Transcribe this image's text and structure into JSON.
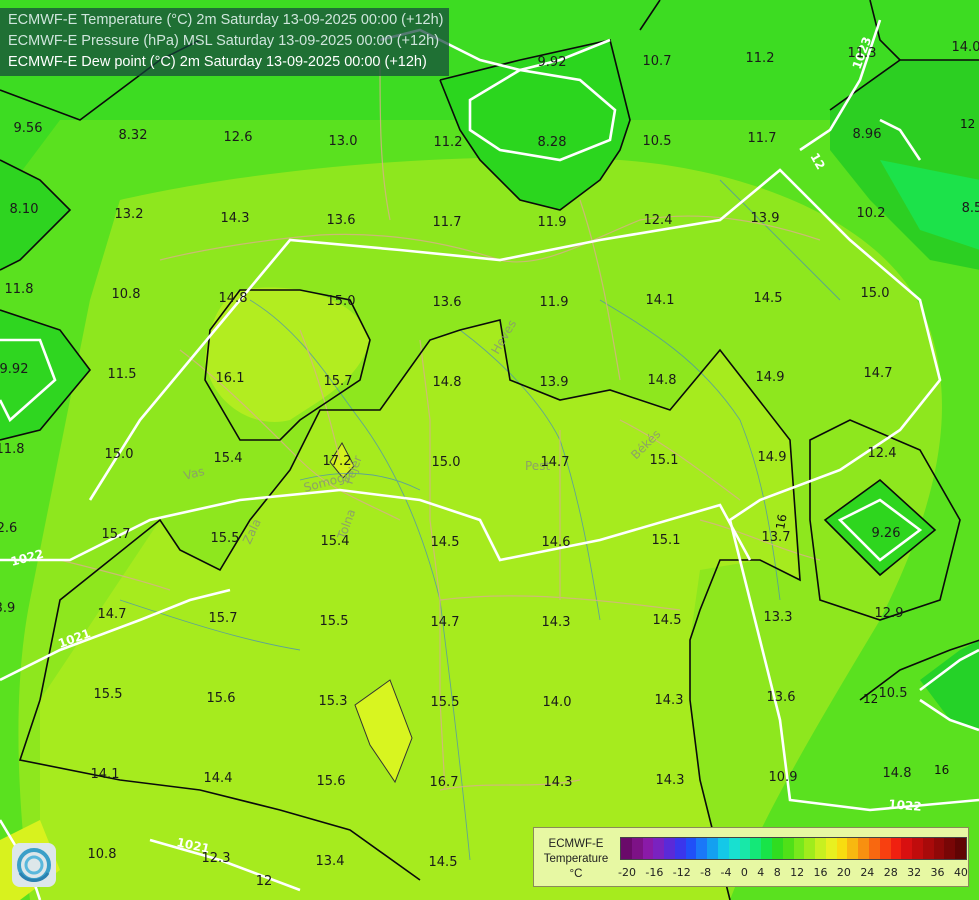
{
  "title_lines": [
    "ECMWF-E Temperature (°C) 2m Saturday 13-09-2025 00:00 (+12h)",
    "ECMWF-E Pressure (hPa) MSL Saturday 13-09-2025 00:00 (+12h)",
    "ECMWF-E Dew point (°C) 2m Saturday 13-09-2025 00:00 (+12h)"
  ],
  "legend": {
    "title_lines": [
      "ECMWF-E",
      "Temperature",
      "°C"
    ],
    "ticks": [
      "-20",
      "-16",
      "-12",
      "-8",
      "-4",
      "0",
      "4",
      "8",
      "12",
      "16",
      "20",
      "24",
      "28",
      "32",
      "36",
      "40"
    ],
    "colors": [
      "#6a0a6a",
      "#7d1286",
      "#8a1aa8",
      "#7a22c0",
      "#5a2ad8",
      "#3a36ec",
      "#2050f8",
      "#1a78f8",
      "#14a0f0",
      "#14c8e8",
      "#18e0d0",
      "#18e8a8",
      "#14e878",
      "#18e448",
      "#30dc20",
      "#50e018",
      "#78e81c",
      "#a0ec1c",
      "#c8f020",
      "#e8f020",
      "#f8dc10",
      "#f8b810",
      "#f89010",
      "#f86810",
      "#f84010",
      "#f02010",
      "#d81010",
      "#c00c0c",
      "#a80a0a",
      "#900808",
      "#780606",
      "#600404"
    ]
  },
  "isobar_labels": [
    "1022",
    "1021",
    "1021",
    "1022",
    "1023",
    "12"
  ],
  "isotherm_labels": [
    "16",
    "12",
    "16",
    "12"
  ],
  "place_labels": [
    "Vas",
    "Somogy",
    "Fejér",
    "Tolna",
    "Zala",
    "Pest",
    "Heves",
    "Békés"
  ],
  "values": [
    "9.56",
    "8.32",
    "12.6",
    "13.0",
    "11.2",
    "8.28",
    "10.5",
    "11.7",
    "8.96",
    "9.92",
    "10.7",
    "11.2",
    "11.3",
    "14.0",
    "8.10",
    "13.2",
    "14.3",
    "13.6",
    "11.7",
    "11.9",
    "12.4",
    "13.9",
    "10.2",
    "8.5",
    "11.8",
    "10.8",
    "14.8",
    "15.0",
    "13.6",
    "11.9",
    "14.1",
    "14.5",
    "15.0",
    "9.92",
    "11.5",
    "16.1",
    "15.7",
    "14.8",
    "13.9",
    "14.8",
    "14.9",
    "14.7",
    "11.8",
    "15.0",
    "15.4",
    "17.2",
    "15.0",
    "14.7",
    "15.1",
    "14.9",
    "12.4",
    "2.6",
    "15.7",
    "15.5",
    "15.4",
    "14.5",
    "14.6",
    "15.1",
    "13.7",
    "9.26",
    "3.9",
    "14.7",
    "15.7",
    "15.5",
    "14.7",
    "14.3",
    "14.5",
    "13.3",
    "12.9",
    "15.5",
    "15.6",
    "15.3",
    "15.5",
    "14.0",
    "14.3",
    "13.6",
    "10.5",
    "14.1",
    "14.4",
    "15.6",
    "16.7",
    "14.3",
    "14.3",
    "10.9",
    "14.8",
    "10.8",
    "12.3",
    "13.4",
    "14.5",
    "12"
  ]
}
